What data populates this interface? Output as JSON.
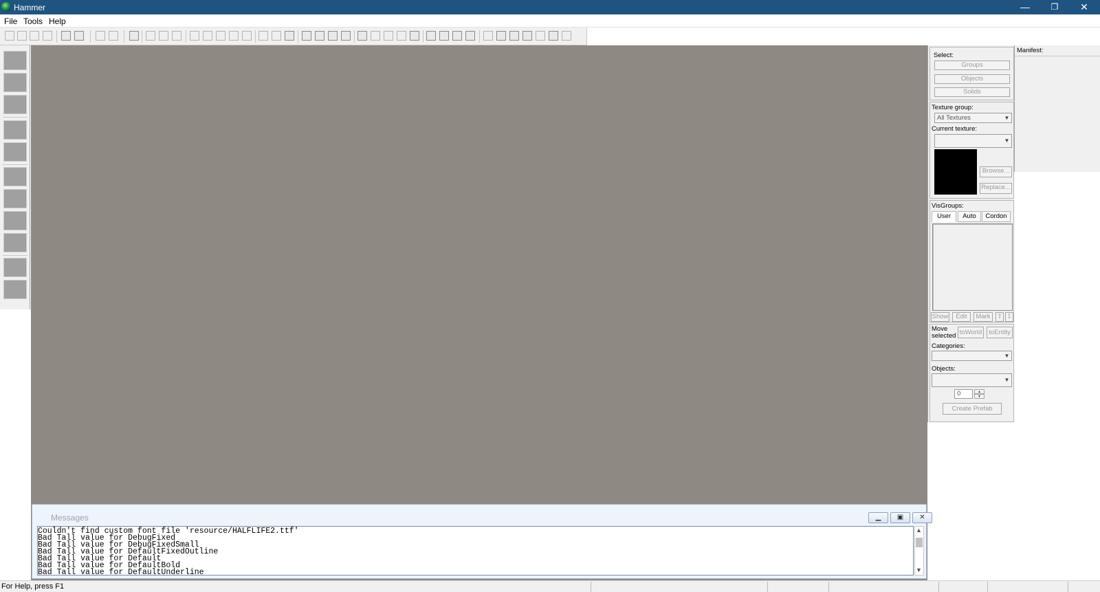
{
  "window": {
    "title": "Hammer",
    "minimize": "—",
    "restore": "❐",
    "close": "✕"
  },
  "menu": [
    {
      "label": "File"
    },
    {
      "label": "Tools"
    },
    {
      "label": "Help"
    }
  ],
  "messages": {
    "title": "Messages",
    "buttons": {
      "minimize": "▁",
      "restore": "▣",
      "close": "✕"
    },
    "lines": [
      "Couldn't find custom font file 'resource/HALFLIFE2.ttf'",
      "Bad Tall value for DebugFixed",
      "Bad Tall value for DebugFixedSmall",
      "Bad Tall value for DefaultFixedOutline",
      "Bad Tall value for Default",
      "Bad Tall value for DefaultBold",
      "Bad Tall value for DefaultUnderline"
    ],
    "scroll_up": "▲",
    "scroll_down": "▼"
  },
  "status": {
    "help_text": "For Help, press F1"
  },
  "side_panel": {
    "select_label": "Select:",
    "groups_button": "Groups",
    "objects_button": "Objects",
    "solids_button": "Solids",
    "texture_group_label": "Texture group:",
    "texture_group_value": "All Textures",
    "current_texture_label": "Current texture:",
    "current_texture_value": "",
    "browse_button": "Browse...",
    "replace_button": "Replace...",
    "visgroups_label": "VisGroups:",
    "tabs": {
      "user": "User",
      "auto": "Auto",
      "cordon": "Cordon"
    },
    "show_button": "Show",
    "edit_button": "Edit",
    "mark_button": "Mark",
    "up_arrow": "⇧",
    "down_arrow": "⇩",
    "move_selected_label": "Move selected",
    "to_world_button": "toWorld",
    "to_entity_button": "toEntity",
    "categories_label": "Categories:",
    "categories_value": "",
    "objects_label": "Objects:",
    "objects_value": "",
    "count_value": "0",
    "spin_up": "▲",
    "spin_down": "▼",
    "create_prefab_button": "Create Prefab"
  },
  "manifest": {
    "label": "Manifest:"
  },
  "icons": {
    "dropdown": "▼"
  }
}
